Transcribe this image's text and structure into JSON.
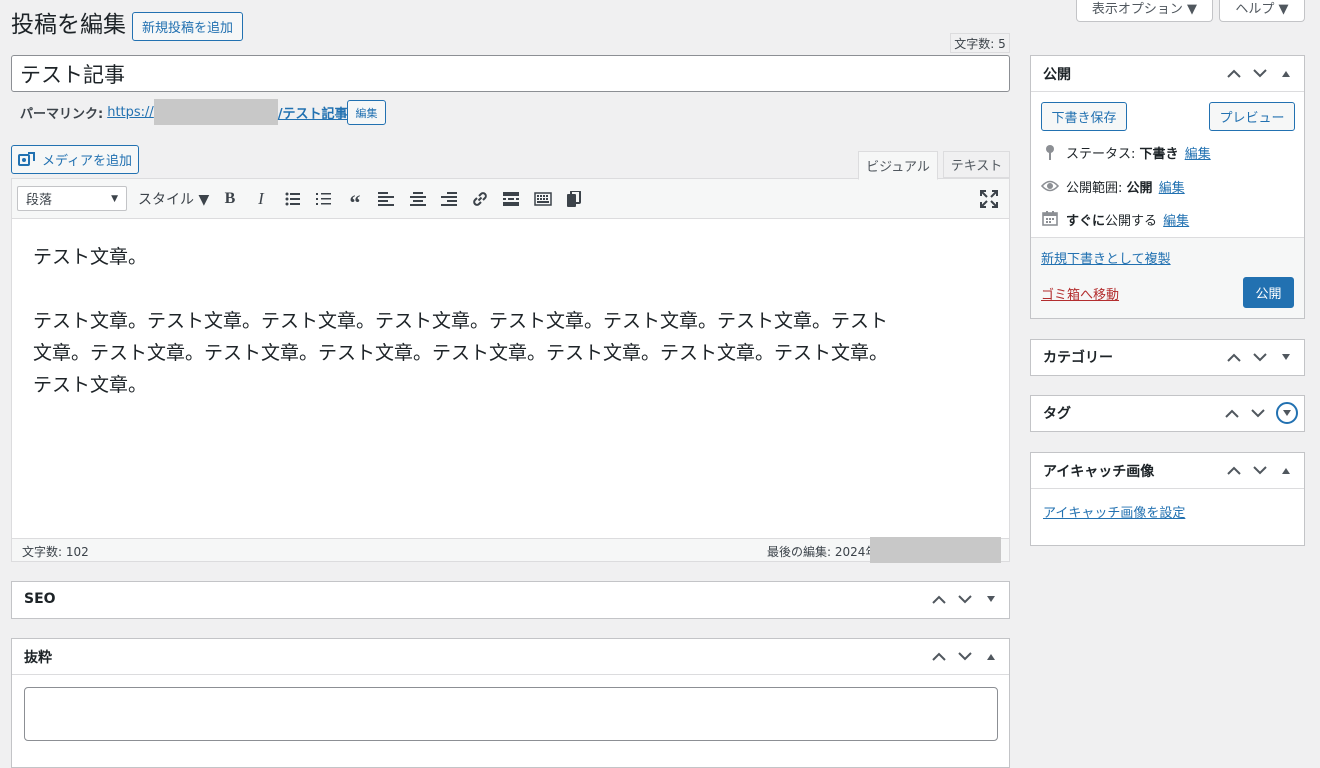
{
  "top_buttons": {
    "screen_options": "表示オプション ▼",
    "help": "ヘルプ ▼"
  },
  "header": {
    "title": "投稿を編集",
    "add_new": "新規投稿を追加"
  },
  "title_field": {
    "char_count": "文字数: 5",
    "value": "テスト記事"
  },
  "permalink": {
    "label": "パーマリンク:",
    "prefix": "https://",
    "suffix": "/テスト記事/",
    "edit": "編集"
  },
  "editor": {
    "add_media": "メディアを追加",
    "tabs": {
      "visual": "ビジュアル",
      "text": "テキスト"
    },
    "format_select": "段落",
    "style_dropdown": "スタイル ▼",
    "paragraphs": [
      "テスト文章。",
      "テスト文章。テスト文章。テスト文章。テスト文章。テスト文章。テスト文章。テスト文章。テスト",
      "文章。テスト文章。テスト文章。テスト文章。テスト文章。テスト文章。テスト文章。テスト文章。",
      "テスト文章。"
    ],
    "status_word_count": "文字数: 102",
    "status_last_edit": "最後の編集: 2024年"
  },
  "seo_box": {
    "title": "SEO"
  },
  "excerpt_box": {
    "title": "抜粋",
    "value": ""
  },
  "publish_box": {
    "title": "公開",
    "save_draft": "下書き保存",
    "preview": "プレビュー",
    "status_label": "ステータス:",
    "status_value": "下書き",
    "visibility_label": "公開範囲:",
    "visibility_value": "公開",
    "schedule_bold": "すぐに",
    "schedule_rest": "公開する",
    "edit": "編集",
    "duplicate": "新規下書きとして複製",
    "trash": "ゴミ箱へ移動",
    "publish": "公開"
  },
  "categories_box": {
    "title": "カテゴリー"
  },
  "tags_box": {
    "title": "タグ"
  },
  "featured_box": {
    "title": "アイキャッチ画像",
    "set_link": "アイキャッチ画像を設定"
  },
  "colors": {
    "accent": "#2271b1",
    "danger": "#b32d2e",
    "border": "#c3c4c7",
    "bg": "#f0f0f1"
  }
}
